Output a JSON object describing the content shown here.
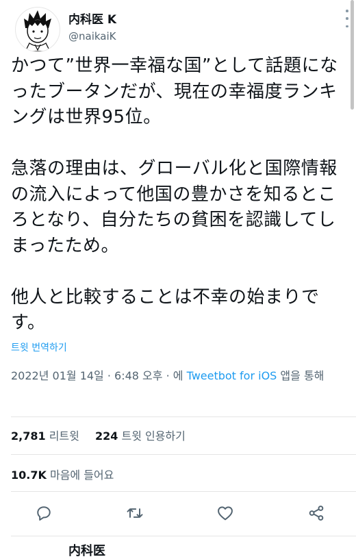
{
  "tweet": {
    "author": {
      "display_name": "内科医 K",
      "handle": "@naikaiK"
    },
    "paragraphs": [
      "かつて”世界一幸福な国”として話題になったブータンだが、現在の幸福度ランキングは世界95位。",
      "急落の理由は、グローバル化と国際情報の流入によって他国の豊かさを知るところとなり、自分たちの貧困を認識してしまったため。",
      "他人と比較することは不幸の始まりです。"
    ],
    "translate_label": "트윗 번역하기",
    "meta": {
      "timestamp": "2022년 01월 14일 · 6:48 오후 · 에",
      "client": "Tweetbot for iOS",
      "suffix": "앱을 통해"
    },
    "stats": {
      "retweets": "2,781",
      "retweets_label": "리트윗",
      "quotes": "224",
      "quotes_label": "트윗 인용하기",
      "likes": "10.7K",
      "likes_label": "마음에 들어요"
    },
    "actions": [
      "reply-icon",
      "retweet-icon",
      "like-icon",
      "share-icon"
    ],
    "next_peek": "内科医"
  },
  "colors": {
    "text": "#0f1419",
    "secondary": "#536471",
    "accent": "#1d9bf0",
    "divider": "#e5e5e5"
  }
}
